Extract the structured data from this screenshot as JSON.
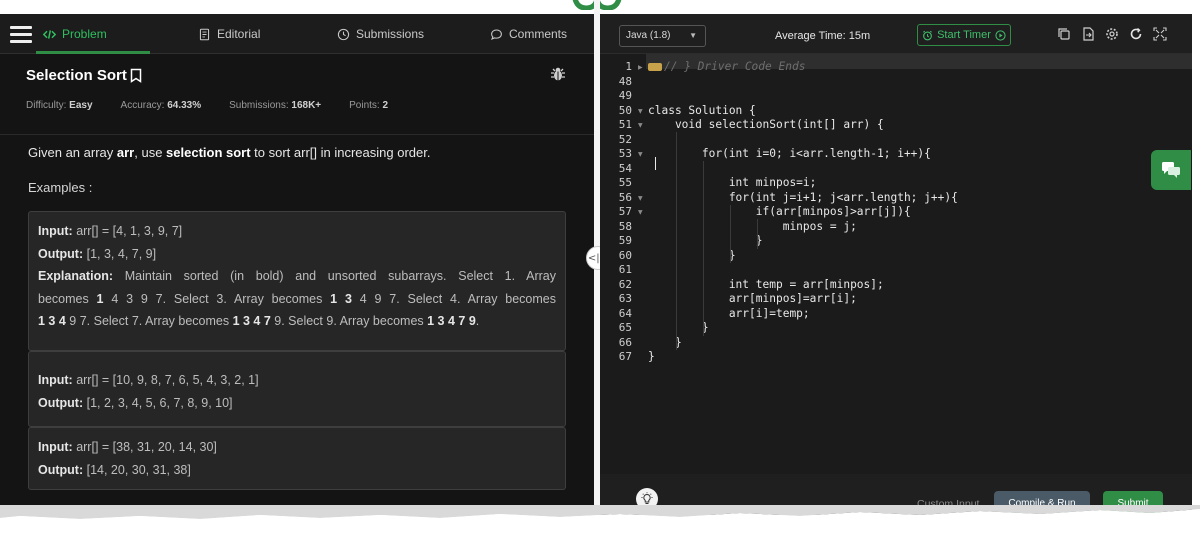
{
  "nav": {
    "tabs": [
      {
        "label": "Problem"
      },
      {
        "label": "Editorial"
      },
      {
        "label": "Submissions"
      },
      {
        "label": "Comments"
      }
    ]
  },
  "problem": {
    "title": "Selection Sort",
    "meta": {
      "difficulty_label": "Difficulty:",
      "difficulty": "Easy",
      "accuracy_label": "Accuracy:",
      "accuracy": "64.33%",
      "submissions_label": "Submissions:",
      "submissions": "168K+",
      "points_label": "Points:",
      "points": "2"
    },
    "desc_pre": "Given an array ",
    "desc_arr": "arr",
    "desc_mid": ", use ",
    "desc_sel": "selection sort",
    "desc_post": " to sort arr[] in increasing order.",
    "examples_heading": "Examples :",
    "examples": [
      {
        "input_label": "Input:",
        "input": " arr[] = [4, 1, 3, 9, 7]",
        "output_label": "Output:",
        "output": " [1, 3, 4, 7, 9]",
        "explanation_label": "Explanation:",
        "exp_l1": " Maintain sorted (in bold) and unsorted subarrays. Select 1. Array",
        "exp_l2a": "becomes ",
        "exp_l2b": "1",
        "exp_l2c": " 4 3 9 7. Select 3. Array becomes ",
        "exp_l2d": "1 3",
        "exp_l2e": " 4 9 7. Select 4. Array becomes",
        "exp_l3a": "1 3 4",
        "exp_l3b": " 9 7. Select 7. Array becomes ",
        "exp_l3c": "1 3 4 7",
        "exp_l3d": " 9. Select 9. Array becomes ",
        "exp_l3e": "1 3 4 7 9",
        "exp_l3f": "."
      },
      {
        "input_label": "Input:",
        "input": " arr[] = [10, 9, 8, 7, 6, 5, 4, 3, 2, 1]",
        "output_label": "Output:",
        "output": " [1, 2, 3, 4, 5, 6, 7, 8, 9, 10]"
      },
      {
        "input_label": "Input:",
        "input": " arr[] = [38, 31, 20, 14, 30]",
        "output_label": "Output:",
        "output": " [14, 20, 30, 31, 38]"
      }
    ]
  },
  "toolbar": {
    "language": "Java (1.8)",
    "avg_time": "Average Time: 15m",
    "start_timer": "Start Timer"
  },
  "editor": {
    "lines": [
      {
        "num": "1",
        "text": "// } Driver Code Ends",
        "comment": true
      },
      {
        "num": "48",
        "text": ""
      },
      {
        "num": "49",
        "text": ""
      },
      {
        "num": "50",
        "text": "class Solution {"
      },
      {
        "num": "51",
        "text": "    void selectionSort(int[] arr) {"
      },
      {
        "num": "52",
        "text": ""
      },
      {
        "num": "53",
        "text": "        for(int i=0; i<arr.length-1; i++){"
      },
      {
        "num": "54",
        "text": ""
      },
      {
        "num": "55",
        "text": "            int minpos=i;"
      },
      {
        "num": "56",
        "text": "            for(int j=i+1; j<arr.length; j++){"
      },
      {
        "num": "57",
        "text": "                if(arr[minpos]>arr[j]){"
      },
      {
        "num": "58",
        "text": "                    minpos = j;"
      },
      {
        "num": "59",
        "text": "                }"
      },
      {
        "num": "60",
        "text": "            }"
      },
      {
        "num": "61",
        "text": ""
      },
      {
        "num": "62",
        "text": "            int temp = arr[minpos];"
      },
      {
        "num": "63",
        "text": "            arr[minpos]=arr[i];"
      },
      {
        "num": "64",
        "text": "            arr[i]=temp;"
      },
      {
        "num": "65",
        "text": "        }"
      },
      {
        "num": "66",
        "text": "    }"
      },
      {
        "num": "67",
        "text": "}"
      }
    ]
  },
  "bottom": {
    "custom_input": "Custom Input",
    "compile_run": "Compile & Run",
    "submit": "Submit"
  },
  "colors": {
    "accent": "#2f8d46",
    "panel_bg": "#141414",
    "editor_bg": "#1b1b1b"
  }
}
